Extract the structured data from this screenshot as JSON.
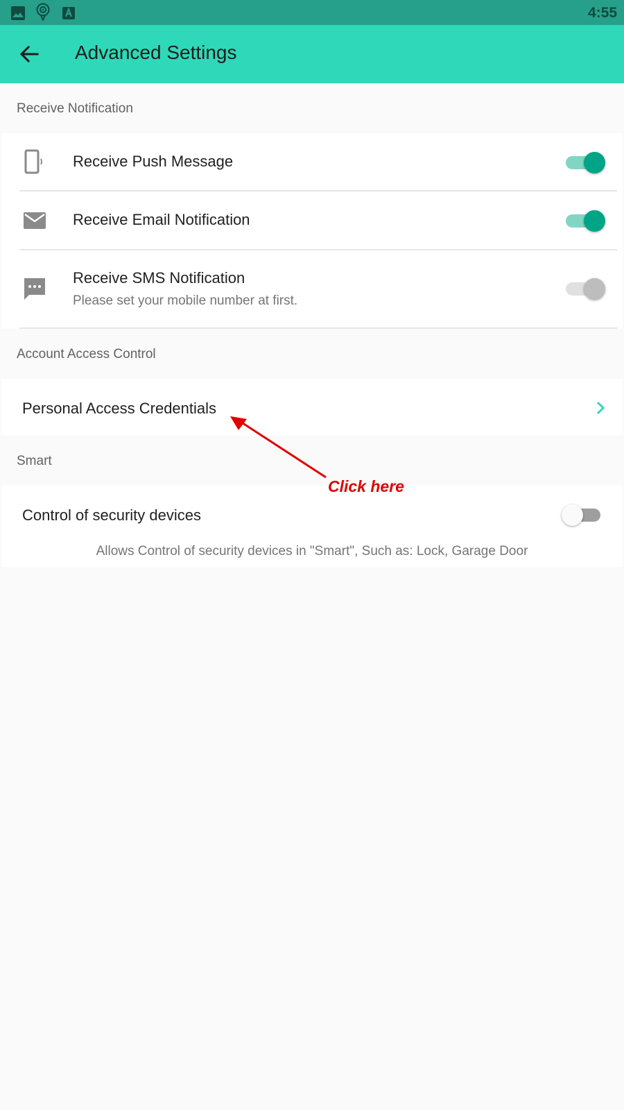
{
  "status_bar": {
    "time": "4:55",
    "icons": [
      "image-icon",
      "location-pin-icon",
      "font-a-icon"
    ],
    "background": "#26a08a"
  },
  "app_bar": {
    "title": "Advanced Settings",
    "back_icon": "arrow-left-icon",
    "background": "#2fd8b8"
  },
  "sections": {
    "receive_notification": {
      "header": "Receive Notification",
      "items": [
        {
          "label": "Receive Push Message",
          "icon": "phone-vibrate-icon",
          "toggle": "on"
        },
        {
          "label": "Receive Email Notification",
          "icon": "mail-icon",
          "toggle": "on"
        },
        {
          "label": "Receive SMS Notification",
          "sublabel": "Please set your mobile number at first.",
          "icon": "sms-icon",
          "toggle": "on-disabled"
        }
      ]
    },
    "account_access": {
      "header": "Account Access Control",
      "item": {
        "label": "Personal Access Credentials",
        "icon": "chevron-right-icon"
      }
    },
    "smart": {
      "header": "Smart",
      "item": {
        "label": "Control of security devices",
        "description": "Allows Control of security devices in \"Smart\", Such as: Lock, Garage Door",
        "toggle": "off"
      }
    }
  },
  "annotation": {
    "text": "Click here",
    "color": "#e00000"
  },
  "colors": {
    "accent": "#00a487",
    "chevron": "#2fd8b8"
  }
}
